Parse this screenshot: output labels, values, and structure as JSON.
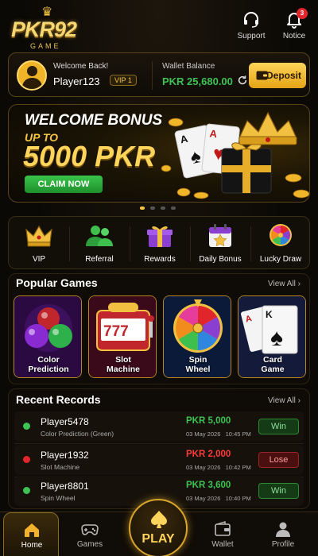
{
  "header": {
    "brand": "PKR92",
    "brand_sub": "GAME",
    "support_label": "Support",
    "notice_label": "Notice",
    "notice_count": "3"
  },
  "user": {
    "welcome": "Welcome Back!",
    "name": "Player123",
    "vip": "VIP 1",
    "wallet_label": "Wallet Balance",
    "wallet_value": "PKR 25,680.00",
    "deposit_label": "Deposit"
  },
  "banner": {
    "line1": "WELCOME BONUS",
    "line2": "UP TO",
    "line3": "5000 PKR",
    "claim_label": "CLAIM NOW",
    "slide_count": 4,
    "active_slide": 0
  },
  "quick_nav": [
    {
      "label": "VIP",
      "icon": "crown-icon"
    },
    {
      "label": "Referral",
      "icon": "users-icon"
    },
    {
      "label": "Rewards",
      "icon": "gift-icon"
    },
    {
      "label": "Daily Bonus",
      "icon": "calendar-star-icon"
    },
    {
      "label": "Lucky Draw",
      "icon": "wheel-icon"
    }
  ],
  "popular": {
    "title": "Popular Games",
    "view_all": "View All",
    "games": [
      {
        "label_1": "Color",
        "label_2": "Prediction"
      },
      {
        "label_1": "Slot",
        "label_2": "Machine"
      },
      {
        "label_1": "Spin",
        "label_2": "Wheel"
      },
      {
        "label_1": "Card",
        "label_2": "Game"
      }
    ]
  },
  "records": {
    "title": "Recent Records",
    "view_all": "View All",
    "rows": [
      {
        "player": "Player5478",
        "game": "Color Prediction (Green)",
        "amount": "PKR 5,000",
        "date": "03 May 2026",
        "time": "10:45 PM",
        "result": "Win",
        "status_color": "#3ec253"
      },
      {
        "player": "Player1932",
        "game": "Slot Machine",
        "amount": "PKR 2,000",
        "date": "03 May 2026",
        "time": "10:42 PM",
        "result": "Lose",
        "status_color": "#e2262b"
      },
      {
        "player": "Player8801",
        "game": "Spin Wheel",
        "amount": "PKR 3,600",
        "date": "03 May 2026",
        "time": "10:40 PM",
        "result": "Win",
        "status_color": "#3ec253"
      }
    ]
  },
  "bottom_nav": {
    "home": "Home",
    "games": "Games",
    "play": "PLAY",
    "wallet": "Wallet",
    "profile": "Profile",
    "active": "Home"
  },
  "colors": {
    "accent_gold": "#f5c542",
    "win_green": "#3ec253",
    "lose_red": "#e2262b",
    "background": "#0b0906"
  }
}
